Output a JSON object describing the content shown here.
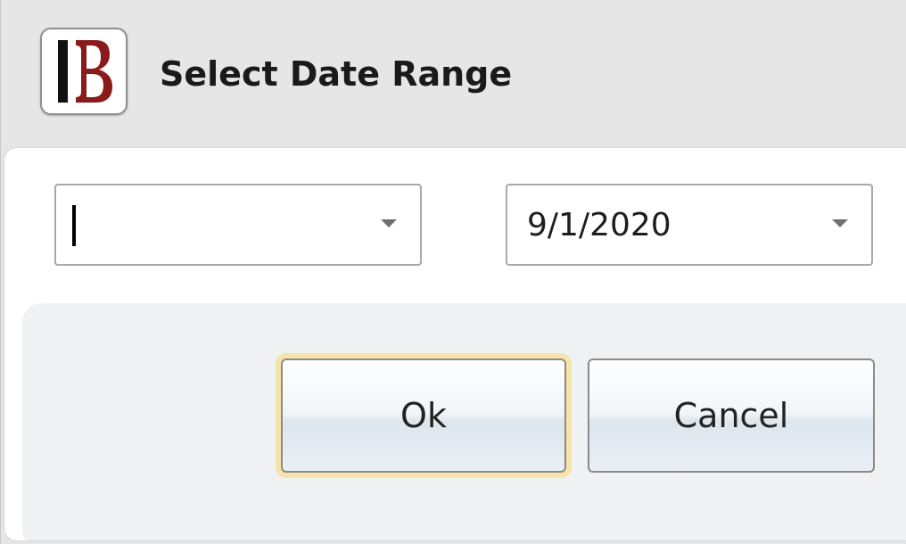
{
  "window": {
    "title": "Select Date Range",
    "app_icon": "b-logo-icon",
    "logo_letter": "B"
  },
  "date_range": {
    "start_date": "",
    "end_date": "9/1/2020"
  },
  "buttons": {
    "ok_label": "Ok",
    "cancel_label": "Cancel"
  },
  "colors": {
    "logo_red": "#8b1a1a",
    "logo_black": "#111111",
    "focus_ring": "#f6e4a8"
  }
}
